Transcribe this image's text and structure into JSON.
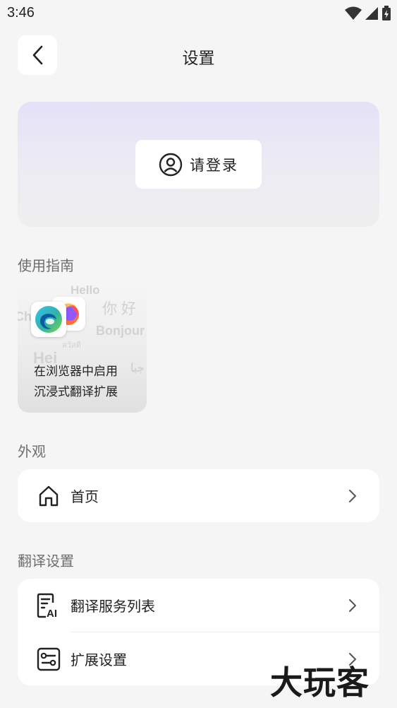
{
  "status_bar": {
    "time": "3:46"
  },
  "header": {
    "title": "设置"
  },
  "login": {
    "label": "请登录"
  },
  "guide": {
    "section_title": "使用指南",
    "card_line1": "在浏览器中启用",
    "card_line2": "沉浸式翻译扩展",
    "deco": {
      "hello": "Hello",
      "nihao": "你 好",
      "bonjour": "Bonjour",
      "thai": "สวัสดี",
      "hei": "Hei",
      "ch": "Ch",
      "arabic": "جبا"
    }
  },
  "appearance": {
    "section_title": "外观",
    "items": [
      {
        "label": "首页",
        "icon": "home-icon"
      }
    ]
  },
  "translation": {
    "section_title": "翻译设置",
    "items": [
      {
        "label": "翻译服务列表",
        "icon": "ai-document-icon"
      },
      {
        "label": "扩展设置",
        "icon": "extension-settings-icon"
      }
    ]
  },
  "watermark": {
    "text": "大玩客"
  }
}
